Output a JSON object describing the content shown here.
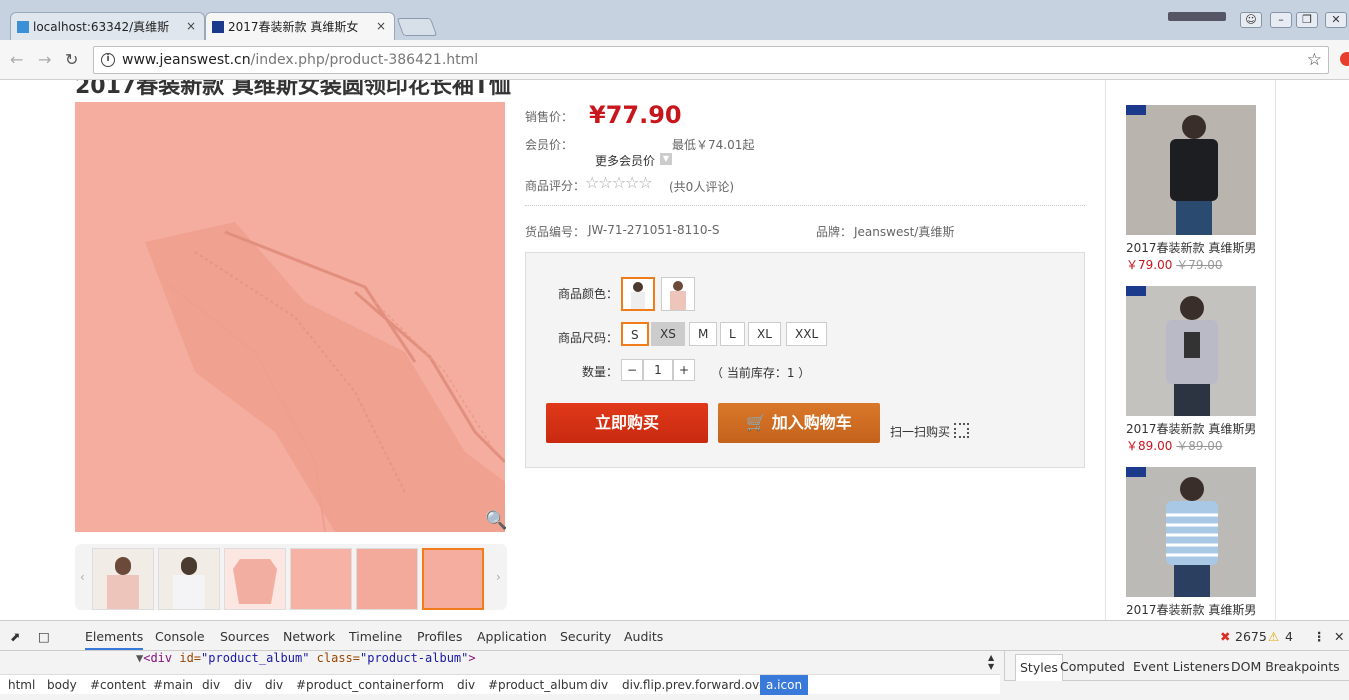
{
  "browser": {
    "tabs": [
      {
        "title": "localhost:63342/真维斯",
        "close": "×"
      },
      {
        "title": "2017春装新款 真维斯女",
        "close": "×"
      }
    ],
    "url_host": "www.jeanswest.cn",
    "url_path": "/index.php/product-386421.html"
  },
  "product": {
    "title_cut": "2017春装新款 真维斯女装圆领印花长袖T恤",
    "sale_label": "销售价：",
    "sale_price": "¥77.90",
    "member_label": "会员价：",
    "member_min": "最低￥74.01起",
    "more_member": "更多会员价",
    "rating_label": "商品评分：",
    "rating_stars": "☆☆☆☆☆",
    "rating_count": "(共0人评论)",
    "sku_label": "货品编号：",
    "sku": "JW-71-271051-8110-S",
    "brand_label": "品牌：",
    "brand": "Jeanswest/真维斯",
    "color_label": "商品颜色：",
    "size_label": "商品尺码：",
    "sizes": [
      "S",
      "XS",
      "M",
      "L",
      "XL",
      "XXL"
    ],
    "qty_label": "数量：",
    "qty_minus": "−",
    "qty_value": "1",
    "qty_plus": "+",
    "stock": "（ 当前库存：1 ）",
    "buy_now": "立即购买",
    "add_cart": "加入购物车",
    "scan_buy": "扫一扫购买"
  },
  "sidebar": {
    "items": [
      {
        "name": "2017春装新款 真维斯男",
        "price": "￥79.00",
        "old": "￥79.00"
      },
      {
        "name": "2017春装新款 真维斯男",
        "price": "￥89.00",
        "old": "￥89.00"
      },
      {
        "name": "2017春装新款 真维斯男"
      }
    ]
  },
  "devtools": {
    "tabs": [
      "Elements",
      "Console",
      "Sources",
      "Network",
      "Timeline",
      "Profiles",
      "Application",
      "Security",
      "Audits"
    ],
    "errors": "2675",
    "warnings": "4",
    "code_tag": "<div ",
    "code_attr1": "id=",
    "code_val1": "\"product_album\"",
    "code_attr2": " class=",
    "code_val2": "\"product-album\"",
    "code_end": ">",
    "breadcrumbs": [
      "html",
      "body",
      "#content",
      "#main",
      "div",
      "div",
      "div",
      "#product_container",
      "form",
      "div",
      "#product_album",
      "div",
      "div.flip.prev.forward.over",
      "a.icon"
    ],
    "side_tabs": [
      "Styles",
      "Computed",
      "Event Listeners",
      "DOM Breakpoints"
    ]
  }
}
